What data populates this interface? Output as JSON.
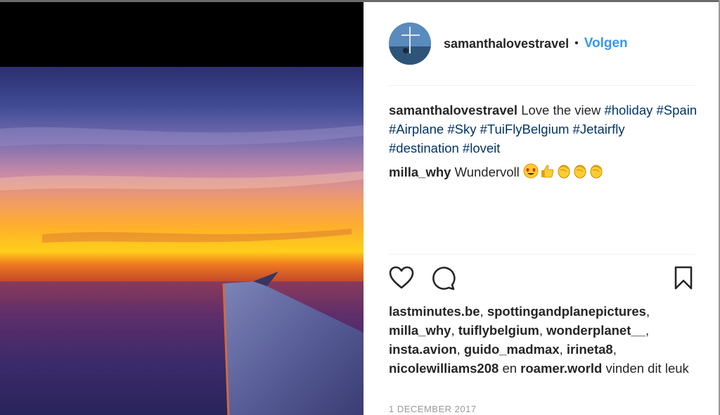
{
  "post": {
    "username": "samanthalovestravel",
    "separator": "•",
    "follow_label": "Volgen",
    "caption": {
      "author": "samanthalovestravel",
      "text": "Love the view",
      "hashtags": [
        "#holiday",
        "#Spain",
        "#Airplane",
        "#Sky",
        "#TuiFlyBelgium",
        "#Jetairfly",
        "#destination",
        "#loveit"
      ]
    },
    "comment": {
      "author": "milla_why",
      "text": "Wundervoll",
      "emojis": [
        "heart-eyes-emoji",
        "thumbs-up-emoji",
        "clapping-hands-emoji",
        "clapping-hands-emoji",
        "clapping-hands-emoji"
      ]
    },
    "likes": {
      "users": [
        "lastminutes.be",
        "spottingandplanepictures",
        "milla_why",
        "tuiflybelgium",
        "wonderplanet__",
        "insta.avion",
        "guido_madmax",
        "irineta8",
        "nicolewilliams208"
      ],
      "conjunction": "en",
      "last_user": "roamer.world",
      "suffix": "vinden dit leuk"
    },
    "date": "1 DECEMBER 2017",
    "icons": {
      "like": "heart-icon",
      "comment": "comment-bubble-icon",
      "save": "bookmark-icon"
    },
    "colors": {
      "follow": "#3897f0",
      "hashtag": "#003569",
      "date": "#999999"
    }
  }
}
